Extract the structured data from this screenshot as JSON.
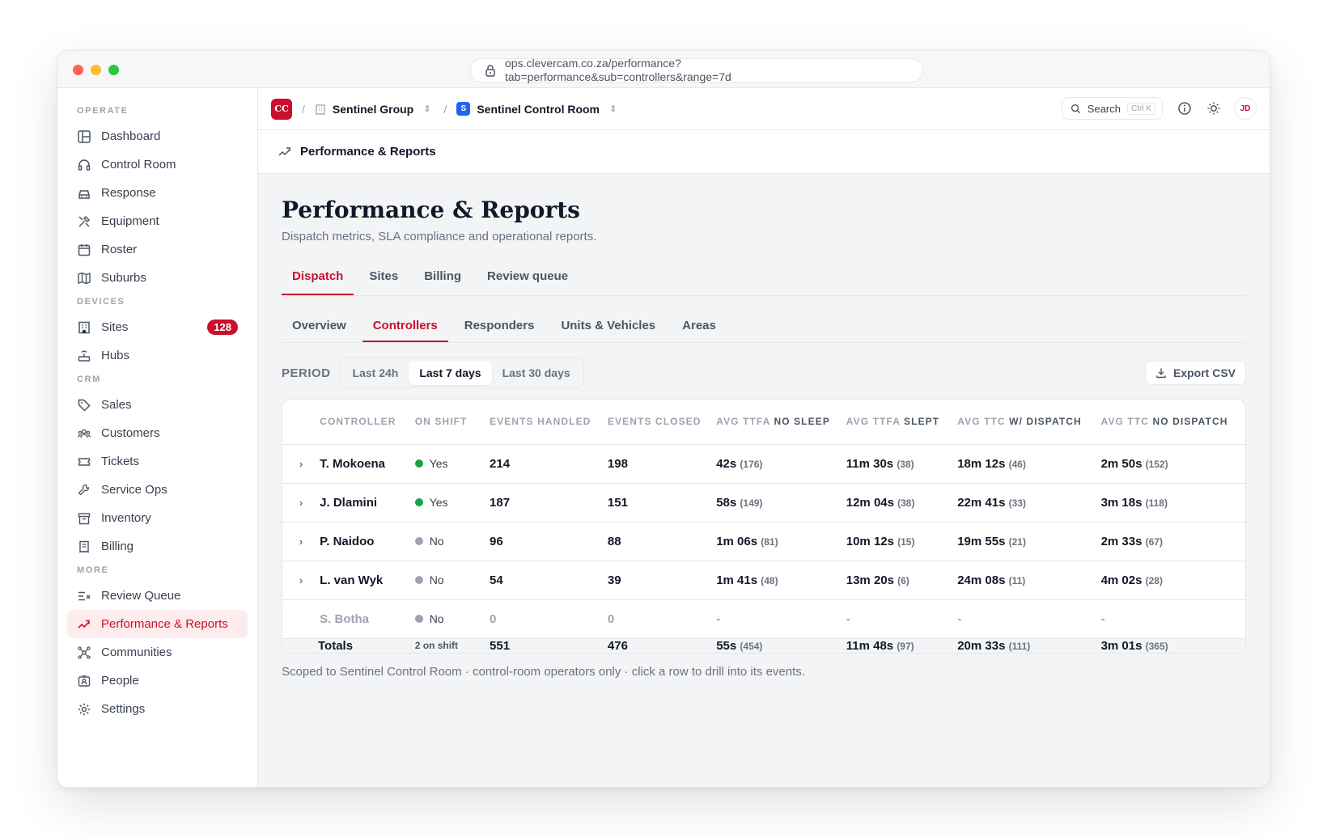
{
  "browser": {
    "url": "ops.clevercam.co.za/performance?tab=performance&sub=controllers&range=7d"
  },
  "sidebar": {
    "sections": [
      {
        "title": "OPERATE",
        "items": [
          {
            "label": "Dashboard",
            "icon": "layout-icon"
          },
          {
            "label": "Control Room",
            "icon": "headset-icon"
          },
          {
            "label": "Response",
            "icon": "car-icon"
          },
          {
            "label": "Equipment",
            "icon": "tools-icon"
          },
          {
            "label": "Roster",
            "icon": "calendar-icon"
          },
          {
            "label": "Suburbs",
            "icon": "map-icon"
          }
        ]
      },
      {
        "title": "DEVICES",
        "items": [
          {
            "label": "Sites",
            "icon": "building-icon",
            "badge": "128"
          },
          {
            "label": "Hubs",
            "icon": "router-icon"
          }
        ]
      },
      {
        "title": "CRM",
        "items": [
          {
            "label": "Sales",
            "icon": "tag-icon"
          },
          {
            "label": "Customers",
            "icon": "users-icon"
          },
          {
            "label": "Tickets",
            "icon": "ticket-icon"
          },
          {
            "label": "Service Ops",
            "icon": "wrench-icon"
          },
          {
            "label": "Inventory",
            "icon": "archive-icon"
          },
          {
            "label": "Billing",
            "icon": "receipt-icon"
          }
        ]
      },
      {
        "title": "MORE",
        "items": [
          {
            "label": "Review Queue",
            "icon": "list-check-icon"
          },
          {
            "label": "Performance & Reports",
            "icon": "trend-icon",
            "active": true
          },
          {
            "label": "Communities",
            "icon": "network-icon"
          },
          {
            "label": "People",
            "icon": "id-card-icon"
          },
          {
            "label": "Settings",
            "icon": "gear-icon"
          }
        ]
      }
    ]
  },
  "topbar": {
    "logo": "CC",
    "org": "Sentinel Group",
    "room_badge": "S",
    "room": "Sentinel Control Room",
    "search_label": "Search",
    "search_kbd": "Ctrl K",
    "avatar": "JD"
  },
  "page_header": {
    "title": "Performance & Reports"
  },
  "page": {
    "title": "Performance & Reports",
    "subtitle": "Dispatch metrics, SLA compliance and operational reports.",
    "tabs": [
      {
        "label": "Dispatch",
        "active": true
      },
      {
        "label": "Sites"
      },
      {
        "label": "Billing"
      },
      {
        "label": "Review queue"
      }
    ],
    "subtabs": [
      {
        "label": "Overview"
      },
      {
        "label": "Controllers",
        "active": true
      },
      {
        "label": "Responders"
      },
      {
        "label": "Units & Vehicles"
      },
      {
        "label": "Areas"
      }
    ],
    "period_label": "PERIOD",
    "periods": [
      {
        "label": "Last 24h"
      },
      {
        "label": "Last 7 days",
        "active": true
      },
      {
        "label": "Last 30 days"
      }
    ],
    "export_label": "Export CSV",
    "footnote": "Scoped to Sentinel Control Room · control-room operators only · click a row to drill into its events."
  },
  "table": {
    "headers": [
      {
        "plain": "CONTROLLER",
        "bold": ""
      },
      {
        "plain": "ON SHIFT",
        "bold": ""
      },
      {
        "plain": "EVENTS HANDLED",
        "bold": ""
      },
      {
        "plain": "EVENTS CLOSED",
        "bold": ""
      },
      {
        "plain": "AVG TTFA ",
        "bold": "NO SLEEP"
      },
      {
        "plain": "AVG TTFA ",
        "bold": "SLEPT"
      },
      {
        "plain": "AVG TTC ",
        "bold": "W/ DISPATCH"
      },
      {
        "plain": "AVG TTC ",
        "bold": "NO DISPATCH"
      }
    ],
    "rows": [
      {
        "name": "T. Mokoena",
        "on_shift": "Yes",
        "status": "on",
        "handled": "214",
        "closed": "198",
        "ttfa_no_sleep": "42s",
        "ttfa_no_sleep_n": "(176)",
        "ttfa_slept": "11m 30s",
        "ttfa_slept_n": "(38)",
        "ttc_dispatch": "18m 12s",
        "ttc_dispatch_n": "(46)",
        "ttc_no_dispatch": "2m 50s",
        "ttc_no_dispatch_n": "(152)"
      },
      {
        "name": "J. Dlamini",
        "on_shift": "Yes",
        "status": "on",
        "handled": "187",
        "closed": "151",
        "ttfa_no_sleep": "58s",
        "ttfa_no_sleep_n": "(149)",
        "ttfa_slept": "12m 04s",
        "ttfa_slept_n": "(38)",
        "ttc_dispatch": "22m 41s",
        "ttc_dispatch_n": "(33)",
        "ttc_no_dispatch": "3m 18s",
        "ttc_no_dispatch_n": "(118)"
      },
      {
        "name": "P. Naidoo",
        "on_shift": "No",
        "status": "off",
        "handled": "96",
        "closed": "88",
        "ttfa_no_sleep": "1m 06s",
        "ttfa_no_sleep_n": "(81)",
        "ttfa_slept": "10m 12s",
        "ttfa_slept_n": "(15)",
        "ttc_dispatch": "19m 55s",
        "ttc_dispatch_n": "(21)",
        "ttc_no_dispatch": "2m 33s",
        "ttc_no_dispatch_n": "(67)"
      },
      {
        "name": "L. van Wyk",
        "on_shift": "No",
        "status": "off",
        "handled": "54",
        "closed": "39",
        "ttfa_no_sleep": "1m 41s",
        "ttfa_no_sleep_n": "(48)",
        "ttfa_slept": "13m 20s",
        "ttfa_slept_n": "(6)",
        "ttc_dispatch": "24m 08s",
        "ttc_dispatch_n": "(11)",
        "ttc_no_dispatch": "4m 02s",
        "ttc_no_dispatch_n": "(28)"
      },
      {
        "name": "S. Botha",
        "on_shift": "No",
        "status": "off",
        "handled": "0",
        "closed": "0",
        "ttfa_no_sleep": "-",
        "ttfa_no_sleep_n": "",
        "ttfa_slept": "-",
        "ttfa_slept_n": "",
        "ttc_dispatch": "-",
        "ttc_dispatch_n": "",
        "ttc_no_dispatch": "-",
        "ttc_no_dispatch_n": "",
        "muted": true
      }
    ],
    "totals": {
      "label": "Totals",
      "on_shift": "2 on shift",
      "handled": "551",
      "closed": "476",
      "ttfa_no_sleep": "55s",
      "ttfa_no_sleep_n": "(454)",
      "ttfa_slept": "11m 48s",
      "ttfa_slept_n": "(97)",
      "ttc_dispatch": "20m 33s",
      "ttc_dispatch_n": "(111)",
      "ttc_no_dispatch": "3m 01s",
      "ttc_no_dispatch_n": "(365)"
    }
  },
  "colors": {
    "accent": "#c8102e",
    "on_shift": "#16a34a",
    "off_shift": "#9ca3af"
  }
}
